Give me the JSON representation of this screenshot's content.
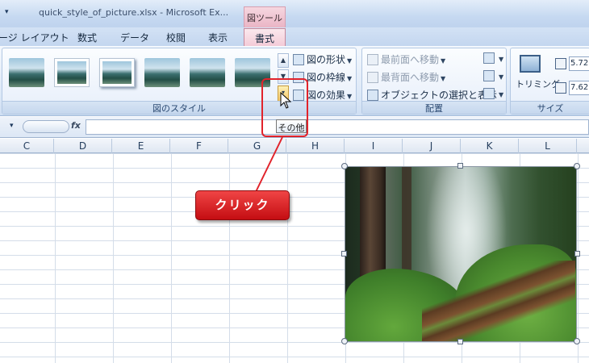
{
  "titlebar": {
    "quick_access_dropdown": "▾",
    "document_title": "quick_style_of_picture.xlsx - Microsoft Ex...",
    "context_tab_group": "図ツール"
  },
  "tabs": [
    {
      "label": "ージ レイアウト"
    },
    {
      "label": "数式"
    },
    {
      "label": "データ"
    },
    {
      "label": "校閲"
    },
    {
      "label": "表示"
    },
    {
      "label": "書式",
      "active": true
    }
  ],
  "ribbon": {
    "picture_styles": {
      "group_label": "図のスタイル",
      "commands": [
        "図の形状",
        "図の枠線",
        "図の効果"
      ]
    },
    "arrange": {
      "group_label": "配置",
      "bring_forward": "最前面へ移動",
      "send_backward": "最背面へ移動",
      "selection_pane": "オブジェクトの選択と表示"
    },
    "size": {
      "group_label": "サイズ",
      "crop_label": "トリミング",
      "height_value": "5.72",
      "width_value": "7.62"
    }
  },
  "tooltip": "その他",
  "formula_bar": {
    "name_dropdown": "▾",
    "fx_label": "fx",
    "formula_value": ""
  },
  "columns": [
    "C",
    "D",
    "E",
    "F",
    "G",
    "H",
    "I",
    "J",
    "K",
    "L"
  ],
  "callout": {
    "text": "クリック",
    "color": "#e1232b"
  },
  "icons": {
    "scroll_up": "▲",
    "scroll_down": "▼",
    "more": "▾"
  }
}
